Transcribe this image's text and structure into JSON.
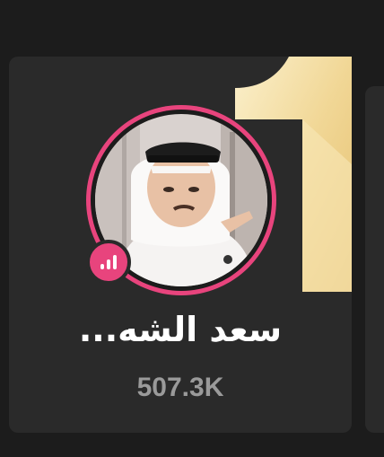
{
  "card": {
    "rank": "1",
    "name": "سعد الشه...",
    "count": "507.3K"
  },
  "colors": {
    "accent": "#e8447d",
    "rank_gold": "#f3dca0",
    "card_bg": "#2a2a2a"
  }
}
